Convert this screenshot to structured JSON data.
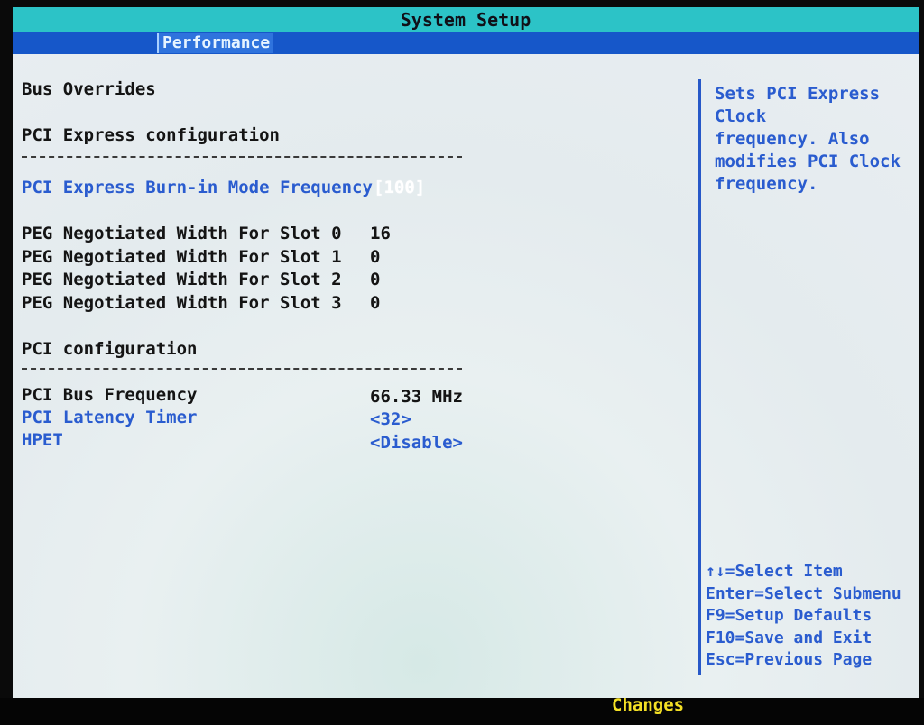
{
  "title": "System Setup",
  "menu": {
    "active_tab": "Performance"
  },
  "main": {
    "section_title": "Bus Overrides",
    "pcie_header": "PCI Express configuration",
    "burnin": {
      "label": "PCI Express Burn-in Mode Frequency",
      "value": "[100]"
    },
    "peg": [
      {
        "label": "PEG Negotiated Width For Slot 0",
        "value": "16"
      },
      {
        "label": "PEG Negotiated Width For Slot 1",
        "value": "0"
      },
      {
        "label": "PEG Negotiated Width For Slot 2",
        "value": "0"
      },
      {
        "label": "PEG Negotiated Width For Slot 3",
        "value": "0"
      }
    ],
    "pci_header": "PCI configuration",
    "bus_freq": {
      "label": "PCI Bus Frequency",
      "value": "66.33 MHz"
    },
    "latency": {
      "label": "PCI Latency Timer",
      "value": "<32>"
    },
    "hpet": {
      "label": "HPET",
      "value": "<Disable>"
    }
  },
  "help": {
    "lines": [
      "Sets PCI Express Clock",
      "frequency. Also",
      "modifies PCI Clock",
      "frequency."
    ]
  },
  "keys": [
    "↑↓=Select Item",
    "Enter=Select Submenu",
    "F9=Setup Defaults",
    "F10=Save and Exit",
    "Esc=Previous Page"
  ],
  "footer": {
    "changes": "Changes"
  },
  "colors": {
    "title_bar": "#2cc3c7",
    "menu_bar": "#1657c9",
    "accent_text": "#2a5ccf",
    "changes": "#f4e025"
  }
}
